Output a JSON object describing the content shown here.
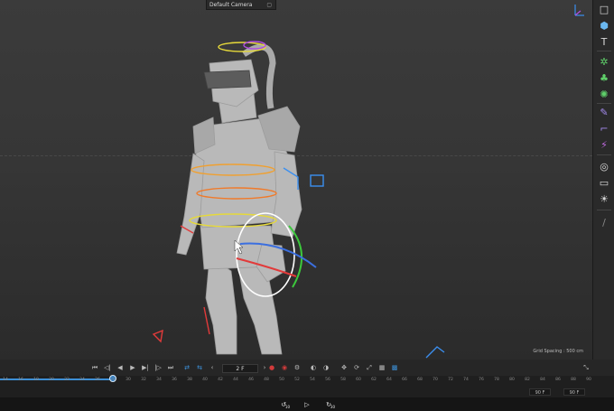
{
  "viewport": {
    "camera_label": "Default Camera",
    "camera_icon": "camera-menu-icon",
    "grid_spacing": "Grid Spacing : 500 cm"
  },
  "toolbar": {
    "items": [
      {
        "icon": "view-cube-icon",
        "glyph": "□"
      },
      {
        "icon": "cube-primitive-icon",
        "glyph": "⬢"
      },
      {
        "icon": "text-tool-icon",
        "glyph": "T"
      },
      {
        "icon": "generator-icon",
        "glyph": "✲"
      },
      {
        "icon": "cloner-icon",
        "glyph": "♣"
      },
      {
        "icon": "deformer-icon",
        "glyph": "✺"
      },
      {
        "icon": "spline-pen-icon",
        "glyph": "✎"
      },
      {
        "icon": "spline-edit-icon",
        "glyph": "⌐"
      },
      {
        "icon": "mograph-icon",
        "glyph": "⚡"
      },
      {
        "icon": "environment-icon",
        "glyph": "◎"
      },
      {
        "icon": "camera-object-icon",
        "glyph": "▭"
      },
      {
        "icon": "light-icon",
        "glyph": "☀"
      },
      {
        "icon": "brush-tool-icon",
        "glyph": "/"
      }
    ]
  },
  "transport": {
    "current_frame": "2 F",
    "buttons": [
      {
        "icon": "go-start-icon",
        "glyph": "⏮"
      },
      {
        "icon": "prev-key-icon",
        "glyph": "◁|"
      },
      {
        "icon": "prev-frame-icon",
        "glyph": "◀"
      },
      {
        "icon": "play-icon",
        "glyph": "▶"
      },
      {
        "icon": "next-frame-icon",
        "glyph": "▶|"
      },
      {
        "icon": "next-key-icon",
        "glyph": "|▷"
      },
      {
        "icon": "go-end-icon",
        "glyph": "⏭"
      }
    ]
  },
  "timeline": {
    "tick_labels": [
      "14",
      "16",
      "18",
      "20",
      "22",
      "24",
      "26",
      "28",
      "30",
      "32",
      "34",
      "36",
      "38",
      "40",
      "42",
      "44",
      "46",
      "48",
      "50",
      "52",
      "54",
      "56",
      "58",
      "60",
      "62",
      "64",
      "66",
      "68",
      "70",
      "72",
      "74",
      "76",
      "78",
      "80",
      "82",
      "84",
      "86",
      "88",
      "90"
    ],
    "progress_fraction": 0.19,
    "range_start": "90 F",
    "range_end": "90 F"
  },
  "playback": {
    "rewind_label": "10",
    "forward_label": "30"
  },
  "colors": {
    "accent": "#3c8fd6",
    "record_red": "#d23b3b",
    "viewport_bg": "#383838"
  }
}
